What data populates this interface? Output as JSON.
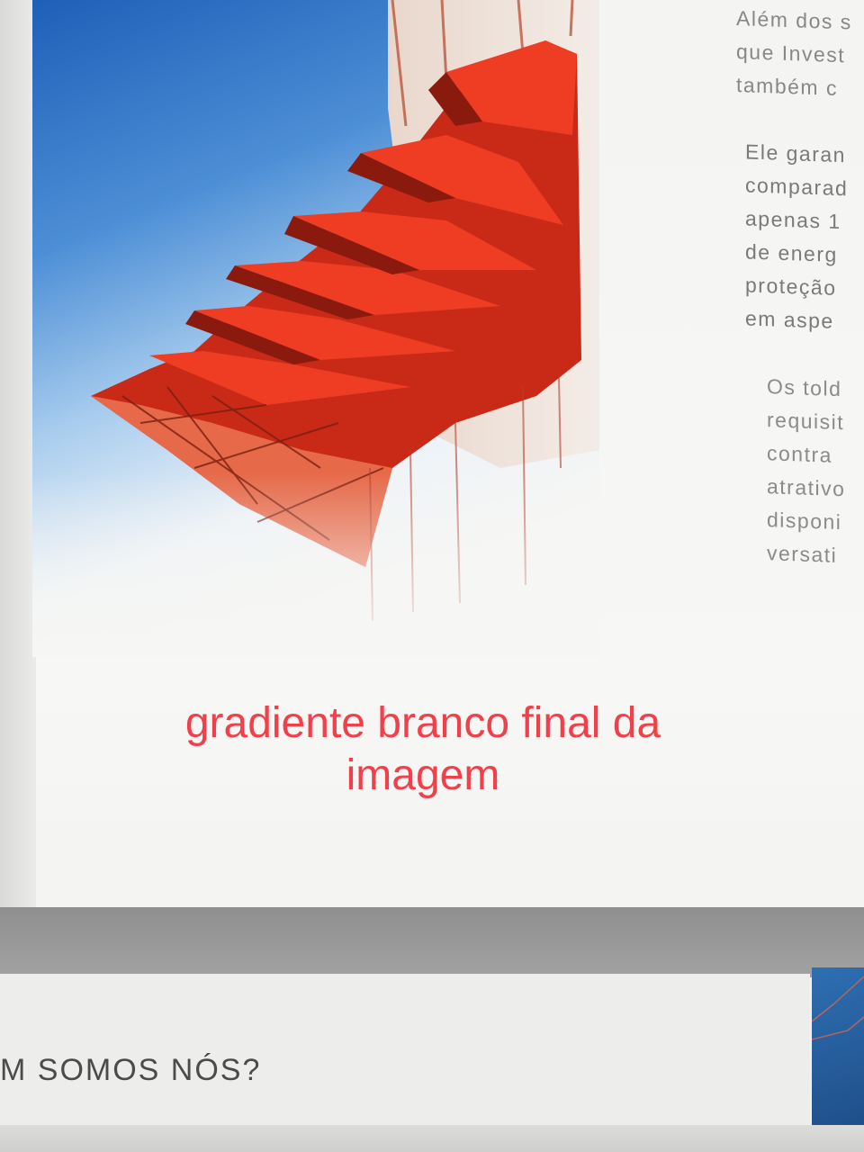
{
  "content": {
    "paragraph_1_lines": [
      "Além dos s",
      "que Invest",
      "também c"
    ],
    "paragraph_2_lines": [
      "Ele garan",
      "comparad",
      "apenas 1",
      "de energ",
      "proteção",
      "em aspe"
    ],
    "paragraph_3_lines": [
      "Os told",
      "requisit",
      "contra",
      "atrativo",
      "disponi",
      "versati"
    ]
  },
  "annotation": {
    "line1": "gradiente branco final da",
    "line2": "imagem",
    "color": "#f2404a"
  },
  "footer": {
    "section_title": "M SOMOS NÓS?"
  },
  "colors": {
    "awning_red": "#e8351f",
    "sky_blue": "#2d74c9",
    "footer_band": "#959595",
    "tile_blue": "#2a66a8"
  }
}
